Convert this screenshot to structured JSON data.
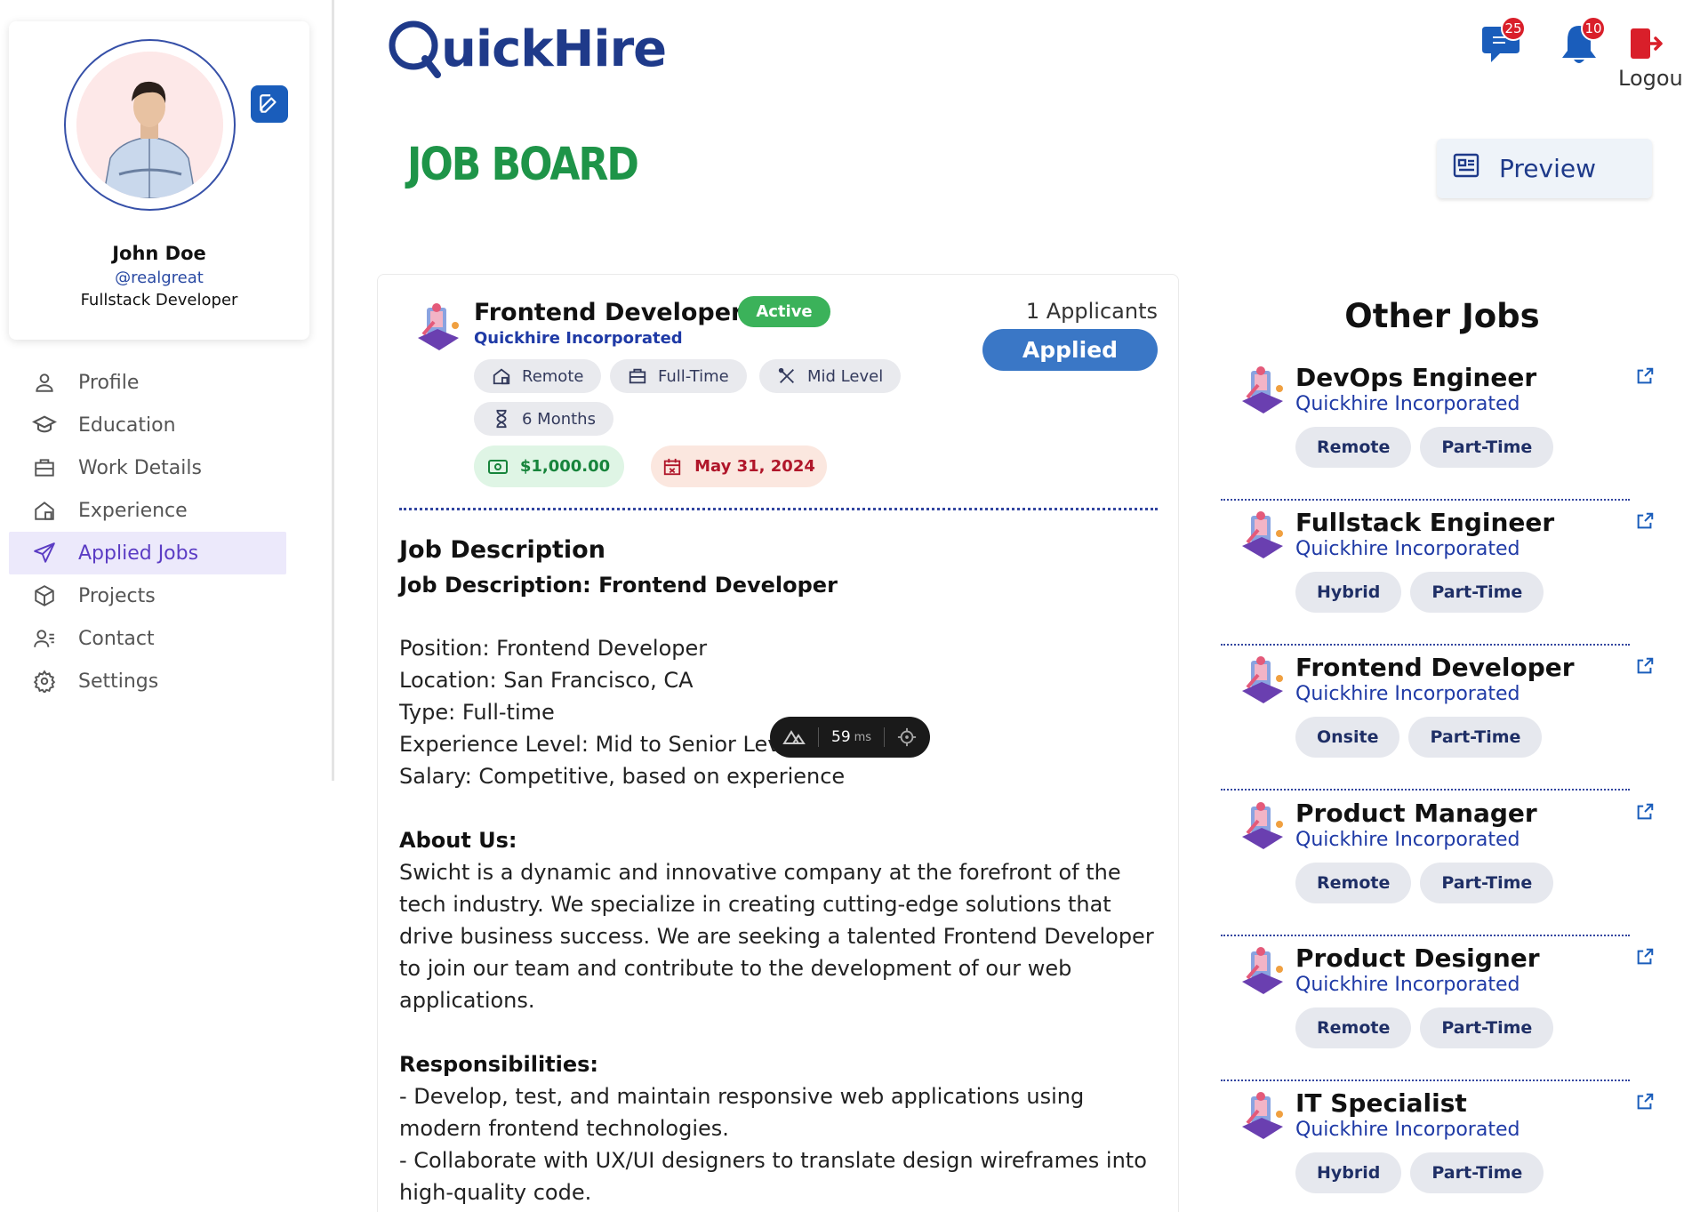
{
  "user": {
    "name": "John Doe",
    "handle": "@realgreat",
    "role": "Fullstack Developer"
  },
  "nav": [
    {
      "label": "Profile",
      "icon": "user-icon"
    },
    {
      "label": "Education",
      "icon": "graduation-cap-icon"
    },
    {
      "label": "Work Details",
      "icon": "briefcase-icon"
    },
    {
      "label": "Experience",
      "icon": "house-icon"
    },
    {
      "label": "Applied Jobs",
      "icon": "send-icon",
      "active": true
    },
    {
      "label": "Projects",
      "icon": "box-icon"
    },
    {
      "label": "Contact",
      "icon": "contact-icon"
    },
    {
      "label": "Settings",
      "icon": "gear-icon"
    }
  ],
  "header": {
    "logo": "QuickHire",
    "messages_count": "25",
    "notifications_count": "10",
    "logout_label": "Logou"
  },
  "page": {
    "title": "JOB BOARD",
    "preview_label": "Preview"
  },
  "job": {
    "title": "Frontend Developer",
    "company": "Quickhire Incorporated",
    "status": "Active",
    "applicants": "1 Applicants",
    "applied_label": "Applied",
    "location_type": "Remote",
    "employment_type": "Full-Time",
    "level": "Mid Level",
    "duration": "6 Months",
    "salary": "$1,000.00",
    "deadline": "May 31, 2024",
    "description": {
      "heading": "Job Description",
      "subheading": "Job Description: Frontend Developer",
      "position": "Position: Frontend Developer",
      "location": "Location: San Francisco, CA",
      "type": "Type: Full-time",
      "experience": "Experience Level: Mid to Senior Level",
      "salary": "Salary: Competitive, based on experience",
      "about_heading": "About Us:",
      "about_text": "Swicht is a dynamic and innovative company at the forefront of the tech industry. We specialize in creating cutting-edge solutions that drive business success. We are seeking a talented Frontend Developer to join our team and contribute to the development of our web applications.",
      "resp_heading": "Responsibilities:",
      "resp_1": "- Develop, test, and maintain responsive web applications using modern frontend technologies.",
      "resp_2": "- Collaborate with UX/UI designers to translate design wireframes into high-quality code."
    }
  },
  "perf_overlay": {
    "value": "59",
    "unit": "ms"
  },
  "other_jobs": {
    "title": "Other Jobs",
    "items": [
      {
        "title": "DevOps Engineer",
        "company": "Quickhire Incorporated",
        "tags": [
          "Remote",
          "Part-Time"
        ]
      },
      {
        "title": "Fullstack Engineer",
        "company": "Quickhire Incorporated",
        "tags": [
          "Hybrid",
          "Part-Time"
        ]
      },
      {
        "title": "Frontend Developer",
        "company": "Quickhire Incorporated",
        "tags": [
          "Onsite",
          "Part-Time"
        ]
      },
      {
        "title": "Product Manager",
        "company": "Quickhire Incorporated",
        "tags": [
          "Remote",
          "Part-Time"
        ]
      },
      {
        "title": "Product Designer",
        "company": "Quickhire Incorporated",
        "tags": [
          "Remote",
          "Part-Time"
        ]
      },
      {
        "title": "IT Specialist",
        "company": "Quickhire Incorporated",
        "tags": [
          "Hybrid",
          "Part-Time"
        ]
      }
    ]
  },
  "colors": {
    "brand": "#1f3a8a",
    "board_title": "#1e9448",
    "active_badge": "#3bb25a",
    "applied_button": "#3a77c6",
    "nav_active": "#5b3cc4"
  }
}
